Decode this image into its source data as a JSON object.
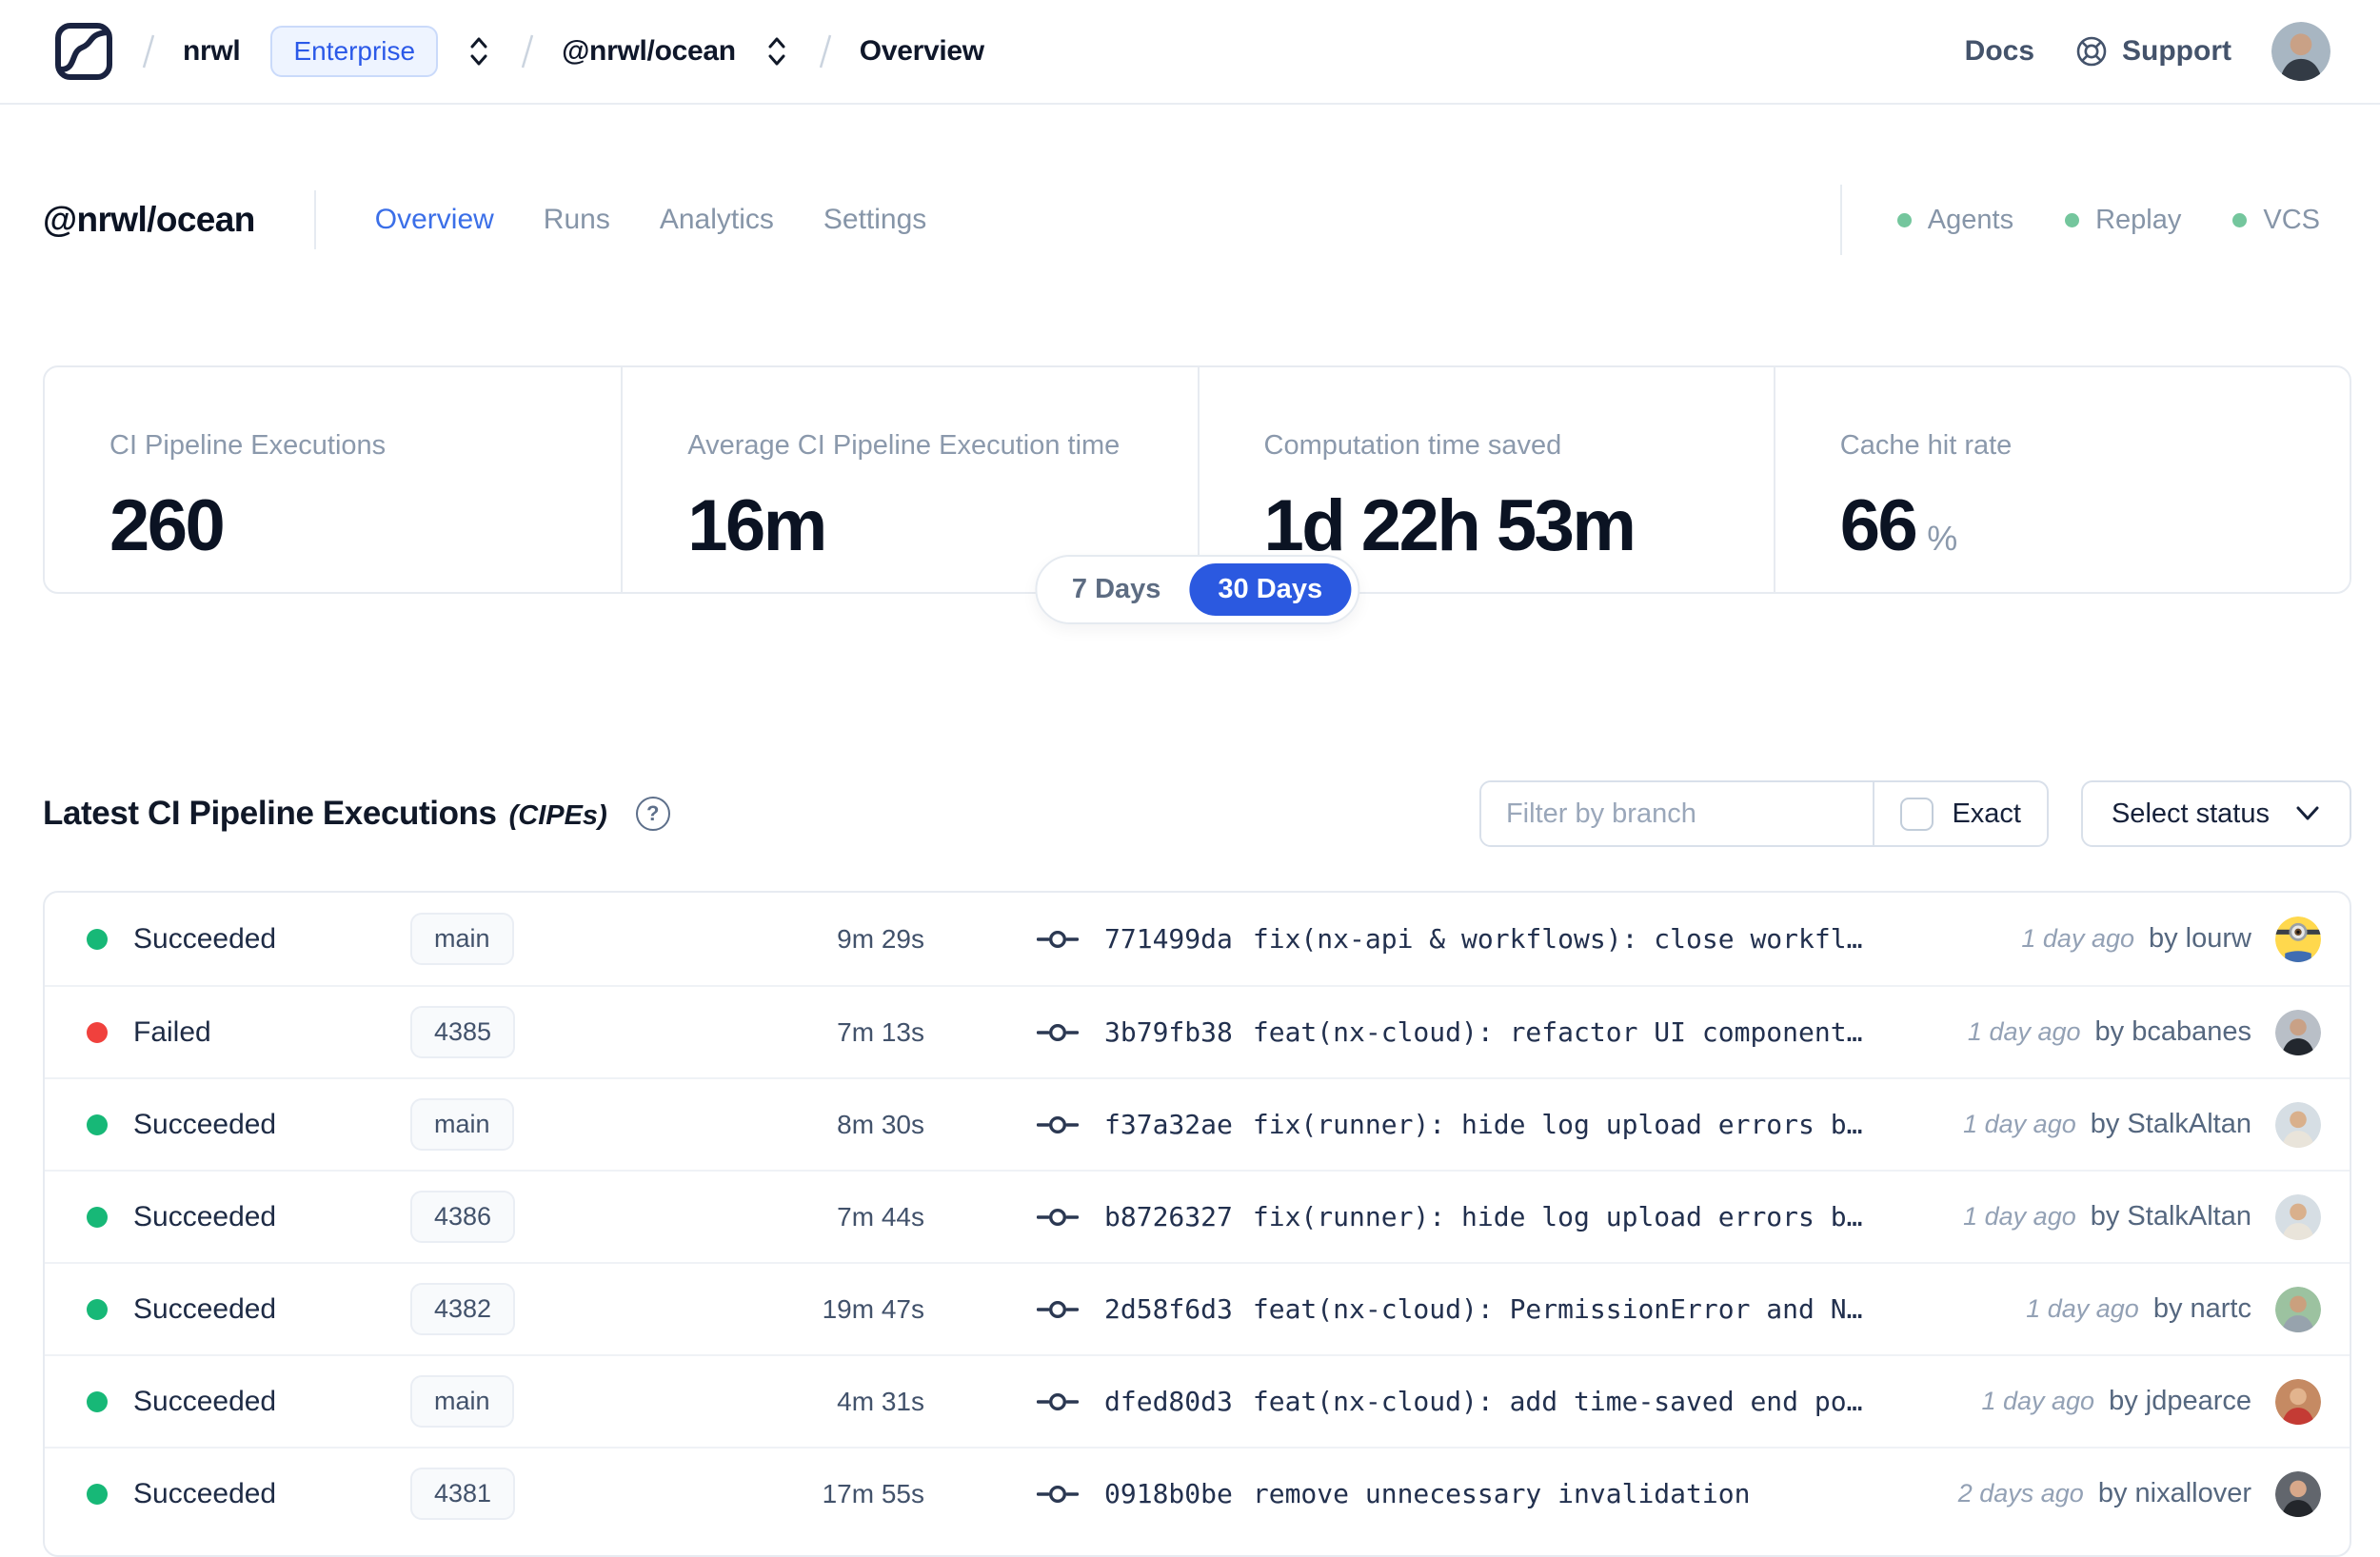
{
  "colors": {
    "accent": "#2b59e0",
    "accent_tab": "#3b6fe8",
    "success": "#17b877",
    "failure": "#f0413d",
    "legend_dot": "#74c69d"
  },
  "topbar": {
    "org": "nrwl",
    "plan_badge": "Enterprise",
    "workspace": "@nrwl/ocean",
    "page": "Overview",
    "docs_label": "Docs",
    "support_label": "Support",
    "avatar": {
      "type": "person",
      "bg": "#a8b6c2",
      "body": "#333b45",
      "skin": "#c9a186"
    }
  },
  "workspace": {
    "title": "@nrwl/ocean",
    "tabs": [
      "Overview",
      "Runs",
      "Analytics",
      "Settings"
    ],
    "active_tab": "Overview",
    "status_indicators": [
      {
        "label": "Agents"
      },
      {
        "label": "Replay"
      },
      {
        "label": "VCS"
      }
    ]
  },
  "stats": {
    "cards": [
      {
        "label": "CI Pipeline Executions",
        "value": "260"
      },
      {
        "label": "Average CI Pipeline Execution time",
        "value": "16m"
      },
      {
        "label": "Computation time saved",
        "value": "1d 22h 53m"
      },
      {
        "label": "Cache hit rate",
        "value": "66",
        "suffix": "%"
      }
    ],
    "range_toggle": {
      "options": [
        "7 Days",
        "30 Days"
      ],
      "selected": "30 Days"
    }
  },
  "cipe_section": {
    "title": "Latest CI Pipeline Executions",
    "title_suffix": "(CIPEs)",
    "filter": {
      "placeholder": "Filter by branch",
      "value": "",
      "exact_label": "Exact",
      "exact_checked": false
    },
    "status_select": {
      "label": "Select status"
    }
  },
  "table": {
    "rows": [
      {
        "status": "Succeeded",
        "state": "success",
        "branch": "main",
        "duration": "9m 29s",
        "commit_hash": "771499da",
        "commit_message": "fix(nx-api & workflows): close workfl…",
        "time_ago": "1 day ago",
        "author": "by lourw",
        "avatar": {
          "type": "minion",
          "bg": "#ffd84d",
          "body": "#3f6db3",
          "skin": "#e8e8e8"
        }
      },
      {
        "status": "Failed",
        "state": "failed",
        "branch": "4385",
        "duration": "7m 13s",
        "commit_hash": "3b79fb38",
        "commit_message": "feat(nx-cloud): refactor UI component…",
        "time_ago": "1 day ago",
        "author": "by bcabanes",
        "avatar": {
          "type": "person",
          "bg": "#b9bfc7",
          "body": "#22272e",
          "skin": "#c9a186"
        }
      },
      {
        "status": "Succeeded",
        "state": "success",
        "branch": "main",
        "duration": "8m 30s",
        "commit_hash": "f37a32ae",
        "commit_message": "fix(runner): hide log upload errors b…",
        "time_ago": "1 day ago",
        "author": "by StalkAltan",
        "avatar": {
          "type": "person",
          "bg": "#d6dee4",
          "body": "#e9e4da",
          "skin": "#d9b08c"
        }
      },
      {
        "status": "Succeeded",
        "state": "success",
        "branch": "4386",
        "duration": "7m 44s",
        "commit_hash": "b8726327",
        "commit_message": "fix(runner): hide log upload errors b…",
        "time_ago": "1 day ago",
        "author": "by StalkAltan",
        "avatar": {
          "type": "person",
          "bg": "#d6dee4",
          "body": "#e9e4da",
          "skin": "#d9b08c"
        }
      },
      {
        "status": "Succeeded",
        "state": "success",
        "branch": "4382",
        "duration": "19m 47s",
        "commit_hash": "2d58f6d3",
        "commit_message": "feat(nx-cloud): PermissionError and N…",
        "time_ago": "1 day ago",
        "author": "by nartc",
        "avatar": {
          "type": "person",
          "bg": "#9cc2a0",
          "body": "#97a3ad",
          "skin": "#caa07e"
        }
      },
      {
        "status": "Succeeded",
        "state": "success",
        "branch": "main",
        "duration": "4m 31s",
        "commit_hash": "dfed80d3",
        "commit_message": "feat(nx-cloud): add time-saved end po…",
        "time_ago": "1 day ago",
        "author": "by jdpearce",
        "avatar": {
          "type": "person",
          "bg": "#c58a63",
          "body": "#c43b34",
          "skin": "#e2b48e"
        }
      },
      {
        "status": "Succeeded",
        "state": "success",
        "branch": "4381",
        "duration": "17m 55s",
        "commit_hash": "0918b0be",
        "commit_message": "remove unnecessary invalidation",
        "time_ago": "2 days ago",
        "author": "by nixallover",
        "avatar": {
          "type": "person",
          "bg": "#62666d",
          "body": "#23262b",
          "skin": "#d8a88a"
        }
      }
    ]
  }
}
